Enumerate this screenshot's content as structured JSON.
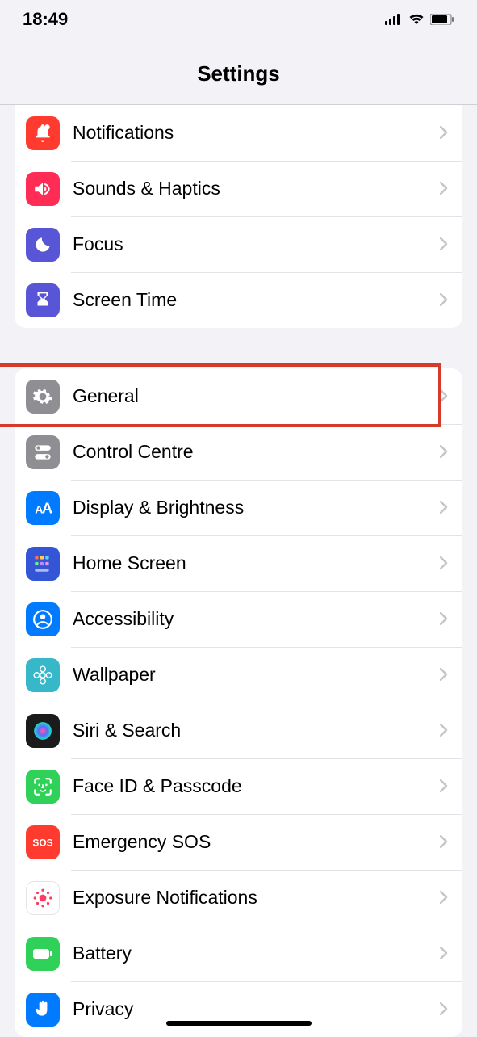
{
  "status": {
    "time": "18:49"
  },
  "header": {
    "title": "Settings"
  },
  "groups": [
    {
      "rows": [
        {
          "id": "notifications",
          "label": "Notifications",
          "bg": "#ff3b30",
          "icon": "bell"
        },
        {
          "id": "sounds-haptics",
          "label": "Sounds & Haptics",
          "bg": "#ff2d55",
          "icon": "speaker"
        },
        {
          "id": "focus",
          "label": "Focus",
          "bg": "#5856d6",
          "icon": "moon"
        },
        {
          "id": "screen-time",
          "label": "Screen Time",
          "bg": "#5856d6",
          "icon": "hourglass"
        }
      ]
    },
    {
      "rows": [
        {
          "id": "general",
          "label": "General",
          "bg": "#8e8e93",
          "icon": "gear",
          "highlighted": true
        },
        {
          "id": "control-centre",
          "label": "Control Centre",
          "bg": "#8e8e93",
          "icon": "switches"
        },
        {
          "id": "display-brightness",
          "label": "Display & Brightness",
          "bg": "#007aff",
          "icon": "aa"
        },
        {
          "id": "home-screen",
          "label": "Home Screen",
          "bg": "#3355d6",
          "icon": "grid"
        },
        {
          "id": "accessibility",
          "label": "Accessibility",
          "bg": "#007aff",
          "icon": "person-circle"
        },
        {
          "id": "wallpaper",
          "label": "Wallpaper",
          "bg": "#37b8c9",
          "icon": "flower"
        },
        {
          "id": "siri-search",
          "label": "Siri & Search",
          "bg": "#1b1b1d",
          "icon": "siri"
        },
        {
          "id": "face-id-passcode",
          "label": "Face ID & Passcode",
          "bg": "#30d158",
          "icon": "faceid"
        },
        {
          "id": "emergency-sos",
          "label": "Emergency SOS",
          "bg": "#ff3b30",
          "icon": "sos"
        },
        {
          "id": "exposure-notifications",
          "label": "Exposure Notifications",
          "bg": "#ffffff",
          "icon": "exposure"
        },
        {
          "id": "battery",
          "label": "Battery",
          "bg": "#30d158",
          "icon": "battery"
        },
        {
          "id": "privacy",
          "label": "Privacy",
          "bg": "#007aff",
          "icon": "hand"
        }
      ]
    }
  ]
}
